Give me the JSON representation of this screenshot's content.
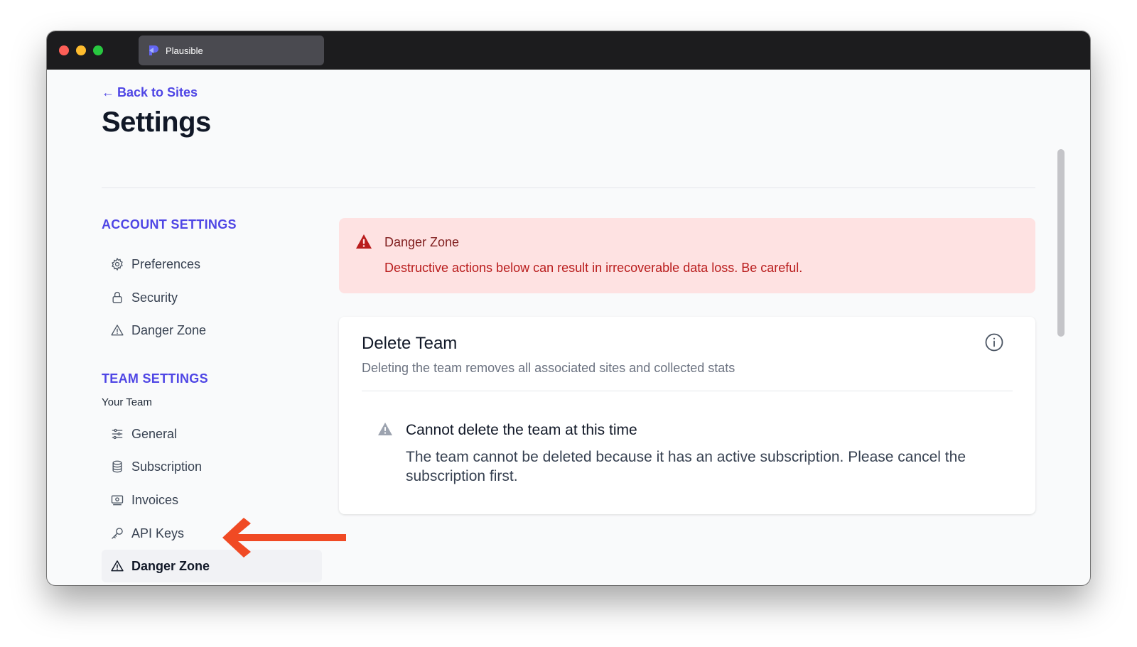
{
  "browser": {
    "tab_title": "Plausible"
  },
  "header": {
    "back_link": "Back to Sites",
    "title": "Settings"
  },
  "sidebar": {
    "account_heading": "ACCOUNT SETTINGS",
    "account_items": [
      {
        "label": "Preferences",
        "icon": "gear-icon"
      },
      {
        "label": "Security",
        "icon": "lock-icon"
      },
      {
        "label": "Danger Zone",
        "icon": "warning-icon"
      }
    ],
    "team_heading": "TEAM SETTINGS",
    "team_name": "Your Team",
    "team_items": [
      {
        "label": "General",
        "icon": "sliders-icon"
      },
      {
        "label": "Subscription",
        "icon": "database-icon"
      },
      {
        "label": "Invoices",
        "icon": "receipt-icon"
      },
      {
        "label": "API Keys",
        "icon": "key-icon"
      },
      {
        "label": "Danger Zone",
        "icon": "warning-icon",
        "active": true
      }
    ]
  },
  "danger_alert": {
    "title": "Danger Zone",
    "text": "Destructive actions below can result in irrecoverable data loss. Be careful."
  },
  "delete_team": {
    "title": "Delete Team",
    "subtitle": "Deleting the team removes all associated sites and collected stats",
    "notice_title": "Cannot delete the team at this time",
    "notice_text": "The team cannot be deleted because it has an active subscription. Please cancel the subscription first."
  },
  "colors": {
    "accent": "#4f46e5",
    "danger_bg": "#fee2e2",
    "danger_text": "#b91c1c",
    "annotation_arrow": "#f04a24"
  }
}
